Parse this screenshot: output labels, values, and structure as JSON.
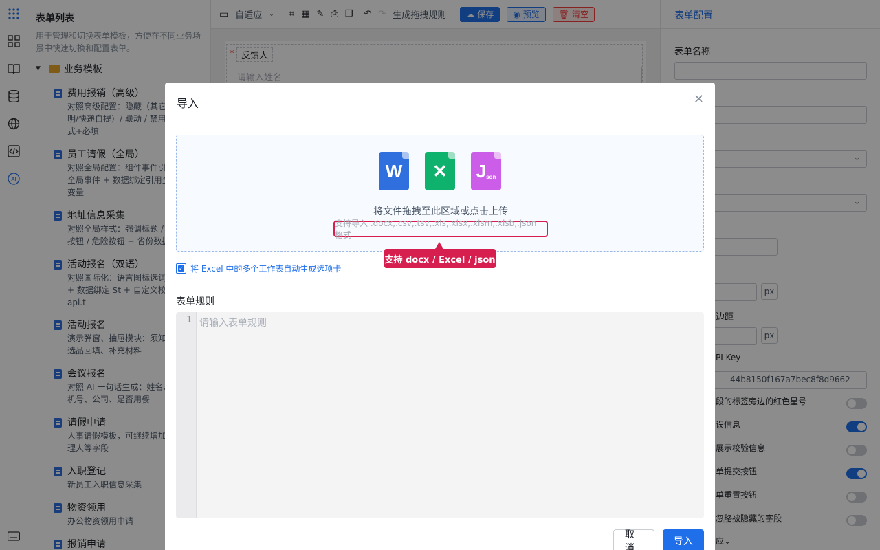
{
  "left_panel": {
    "title": "表单列表",
    "description": "用于管理和切换表单模板，方便在不同业务场景中快速切换和配置表单。",
    "folder": "业务模板",
    "templates": [
      {
        "name": "费用报销（高级）",
        "desc": "对照高级配置：隐藏（其它\n明/快递自提）/ 联动 / 禁用\n式+必填"
      },
      {
        "name": "员工请假（全局）",
        "desc": "对照全局配置：组件事件引\n全局事件 + 数据绑定引用全\n变量"
      },
      {
        "name": "地址信息采集",
        "desc": "对照全局样式：强调标题 /\n按钮 / 危险按钮 + 省份数据"
      },
      {
        "name": "活动报名（双语）",
        "desc": "对照国际化：语言图标选词\n+ 数据绑定 $t + 自定义校验\napi.t"
      },
      {
        "name": "活动报名",
        "desc": "演示弹窗、抽屉模块：须知\n选品回填、补充材料"
      },
      {
        "name": "会议报名",
        "desc": "对照 AI 一句话生成：姓名、\n机号、公司、是否用餐"
      },
      {
        "name": "请假申请",
        "desc": "人事请假模板，可继续增加\n理人等字段"
      },
      {
        "name": "入职登记",
        "desc": "新员工入职信息采集"
      },
      {
        "name": "物资领用",
        "desc": "办公物资领用申请"
      },
      {
        "name": "报销申请",
        "desc": ""
      }
    ]
  },
  "toolbar": {
    "zoom_label": "自适应",
    "generate_rule": "生成拖拽规则",
    "save": "保存",
    "preview": "预览",
    "clear": "清空"
  },
  "canvas": {
    "field_label": "反馈人",
    "field_placeholder": "请输入姓名"
  },
  "right_panel": {
    "tab": "表单配置",
    "form_name_label": "表单名称",
    "api_key_label": "PI Key",
    "api_key_value": "44b8150f167a7bec8f8d9662",
    "margin_label": "边距",
    "unit": "px",
    "toggle_labels": [
      "段的标签旁边的红色星号",
      "误信息",
      "展示校验信息",
      "单提交按钮",
      "单重置按钮",
      "忽略被隐藏的字段"
    ],
    "toggle_states": [
      false,
      true,
      false,
      true,
      false,
      false
    ],
    "bottom_label": "应"
  },
  "modal": {
    "title": "导入",
    "drop_text": "将文件拖拽至此区域或点击上传",
    "formats": "支持导入 .docx,.csv,.tsv,.xls,.xlsx,.xlsm,.xlsb,.json 格式",
    "callout": "支持 docx / Excel / json",
    "checkbox_label": "将 Excel 中的多个工作表自动生成选项卡",
    "rules_label": "表单规则",
    "line_number": "1",
    "rules_placeholder": "请输入表单规则",
    "cancel": "取消",
    "import": "导入",
    "icons": {
      "word": "W",
      "excel": "✕",
      "json": "J",
      "json_sub": "son"
    }
  },
  "colors": {
    "primary": "#1f6feb",
    "callout": "#d61f4f",
    "word": "#2f6fde",
    "excel": "#0fb26c",
    "json": "#cc5de8"
  }
}
